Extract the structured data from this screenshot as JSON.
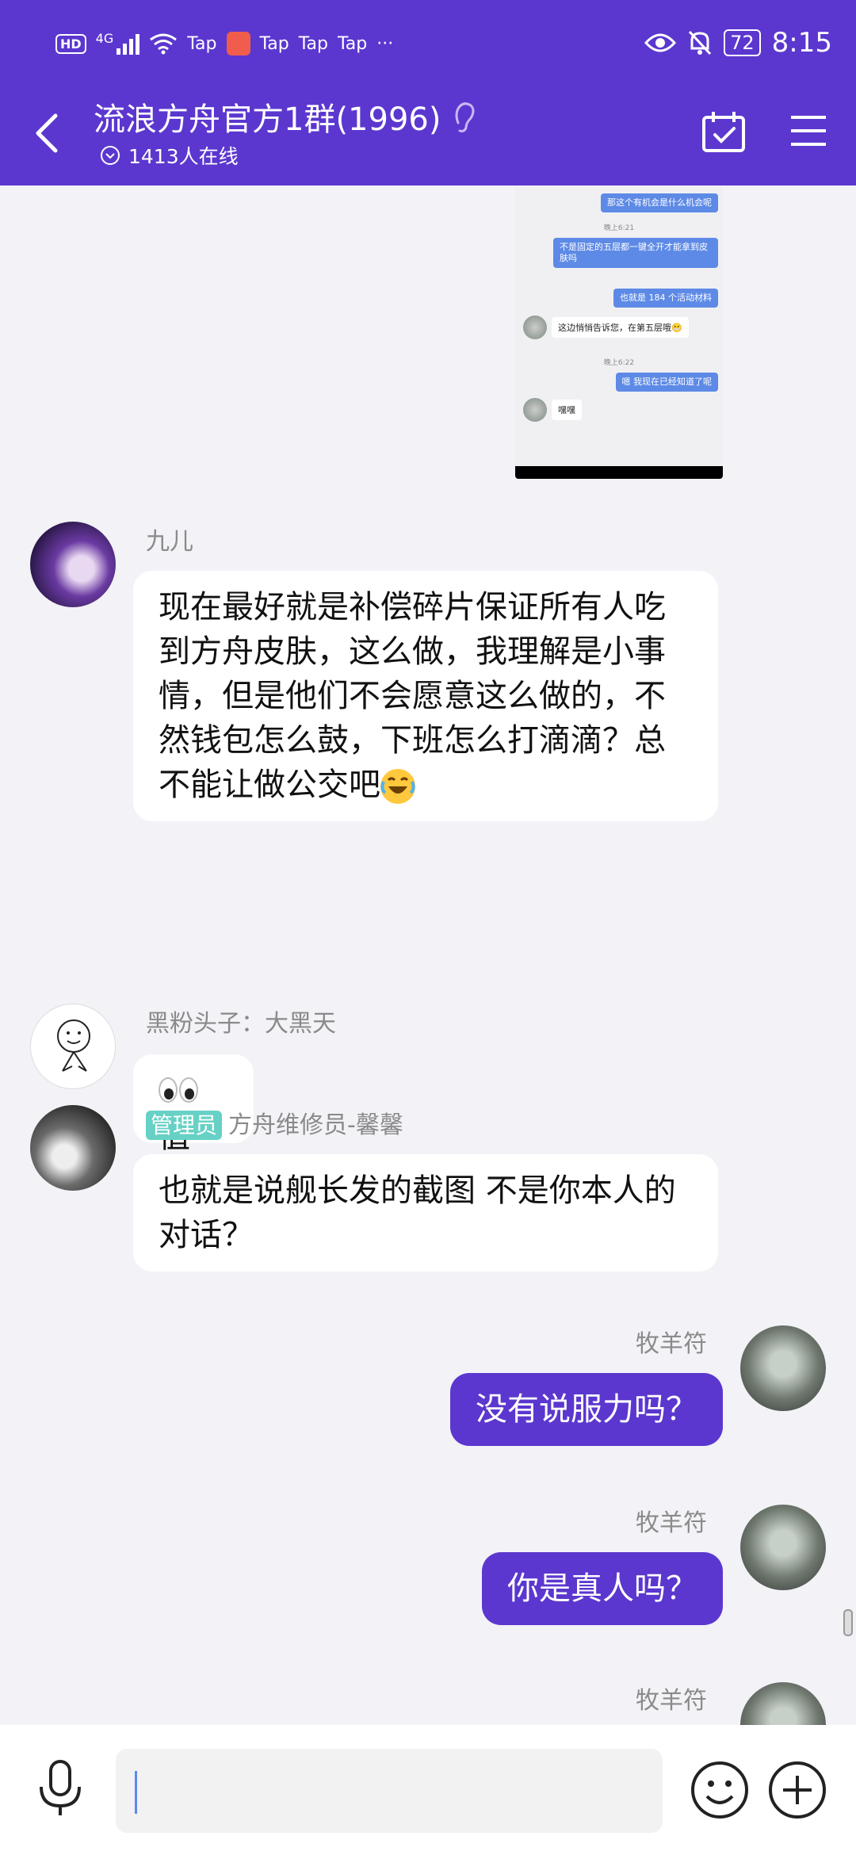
{
  "status_bar": {
    "hd": "HD",
    "network": "4G",
    "tap_labels": [
      "Tap",
      "Tap",
      "Tap",
      "Tap"
    ],
    "more": "···",
    "battery": "72",
    "time": "8:15"
  },
  "header": {
    "title": "流浪方舟官方1群(1996)",
    "online_count": "1413人在线"
  },
  "screenshot_preview": {
    "messages": [
      {
        "type": "out",
        "text": "那这个有机会是什么机会呢"
      },
      {
        "type": "time",
        "text": "晚上6:21"
      },
      {
        "type": "out",
        "text": "不是固定的五层都一键全开才能拿到皮肤吗"
      },
      {
        "type": "out",
        "text": "也就是 184 个活动材料"
      },
      {
        "type": "in",
        "text": "这边悄悄告诉您，在第五层哦😬"
      },
      {
        "type": "time",
        "text": "晚上6:22"
      },
      {
        "type": "out",
        "text": "嗯 我现在已经知道了呢"
      },
      {
        "type": "in",
        "text": "嘿嘿"
      }
    ]
  },
  "messages": [
    {
      "sender": "九儿",
      "text": "现在最好就是补偿碎片保证所有人吃到方舟皮肤，这么做，我理解是小事情，但是他们不会愿意这么做的，不然钱包怎么鼓，下班怎么打滴滴？总不能让做公交吧",
      "emoji": "face-with-tears-of-joy"
    },
    {
      "sender": "黑粉头子：大黑天",
      "text": "值",
      "emoji": "eyes"
    },
    {
      "badge": "管理员",
      "sender": "方舟维修员-馨馨",
      "text": "也就是说舰长发的截图 不是你本人的对话？"
    },
    {
      "sender": "牧羊符",
      "text": "没有说服力吗？"
    },
    {
      "sender": "牧羊符",
      "text": "你是真人吗？"
    },
    {
      "sender": "牧羊符"
    }
  ],
  "input": {
    "placeholder": ""
  },
  "colors": {
    "brand": "#5B37CF",
    "admin_badge": "#66D1C4",
    "background": "#F2F2F7"
  }
}
